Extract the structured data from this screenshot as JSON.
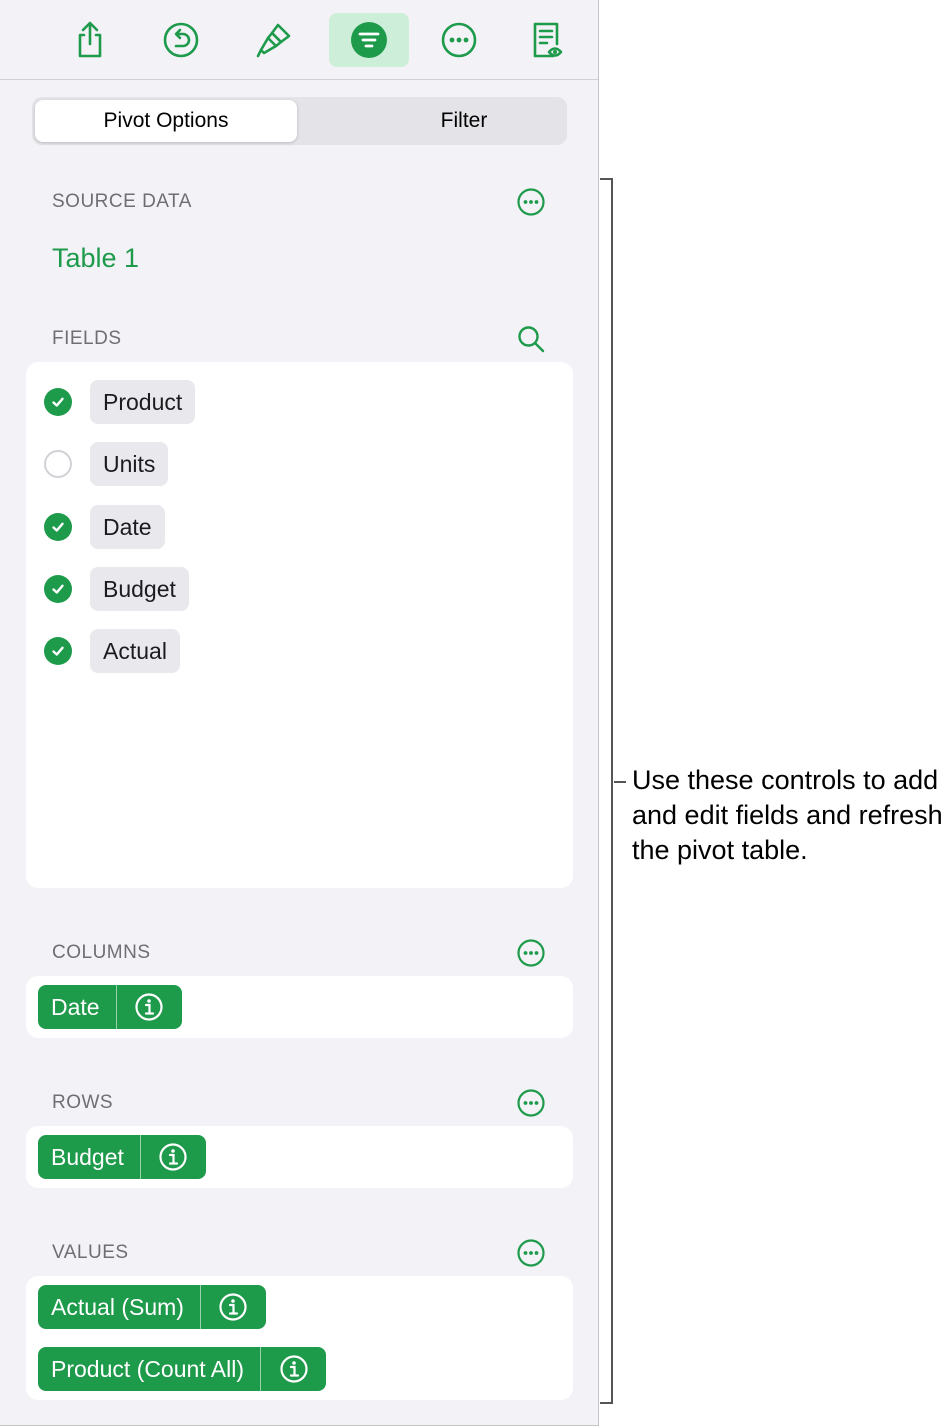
{
  "toolbar": {
    "items": [
      {
        "icon": "share-icon"
      },
      {
        "icon": "undo-icon"
      },
      {
        "icon": "paintbrush-icon"
      },
      {
        "icon": "organize-icon",
        "active": true
      },
      {
        "icon": "more-icon"
      },
      {
        "icon": "reading-view-icon"
      }
    ]
  },
  "tabs": {
    "pivot_options": "Pivot Options",
    "filter": "Filter"
  },
  "source_data": {
    "label": "SOURCE DATA",
    "table": "Table 1"
  },
  "fields": {
    "label": "FIELDS",
    "items": [
      {
        "name": "Product",
        "checked": true
      },
      {
        "name": "Units",
        "checked": false
      },
      {
        "name": "Date",
        "checked": true
      },
      {
        "name": "Budget",
        "checked": true
      },
      {
        "name": "Actual",
        "checked": true
      }
    ]
  },
  "columns": {
    "label": "COLUMNS",
    "items": [
      "Date"
    ]
  },
  "rows": {
    "label": "ROWS",
    "items": [
      "Budget"
    ]
  },
  "values": {
    "label": "VALUES",
    "items": [
      "Actual (Sum)",
      "Product (Count All)"
    ]
  },
  "callout": {
    "text": "Use these controls to add and edit fields and refresh the pivot table."
  },
  "colors": {
    "accent": "#1e9a4b",
    "active_tool_bg": "#cdeed9",
    "panel_bg": "#f2f2f7"
  }
}
